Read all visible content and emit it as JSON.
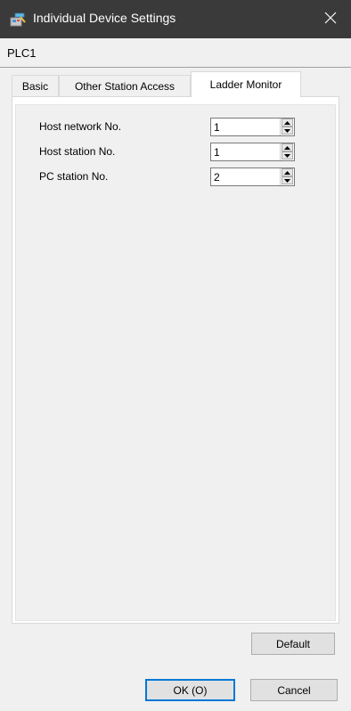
{
  "window": {
    "title": "Individual Device Settings",
    "app_icon": "device-settings-icon",
    "close_icon": "close-icon"
  },
  "device": {
    "name": "PLC1"
  },
  "tabs": [
    {
      "label": "Basic",
      "active": false
    },
    {
      "label": "Other Station Access",
      "active": false
    },
    {
      "label": "Ladder Monitor",
      "active": true
    }
  ],
  "fields": [
    {
      "label": "Host network No.",
      "value": "1"
    },
    {
      "label": "Host station No.",
      "value": "1"
    },
    {
      "label": "PC station No.",
      "value": "2"
    }
  ],
  "buttons": {
    "default_label": "Default",
    "ok_label": "OK (O)",
    "cancel_label": "Cancel"
  },
  "colors": {
    "titlebar": "#3a3a3a",
    "focus_border": "#0078d7",
    "dialog_bg": "#f0f0f0"
  }
}
